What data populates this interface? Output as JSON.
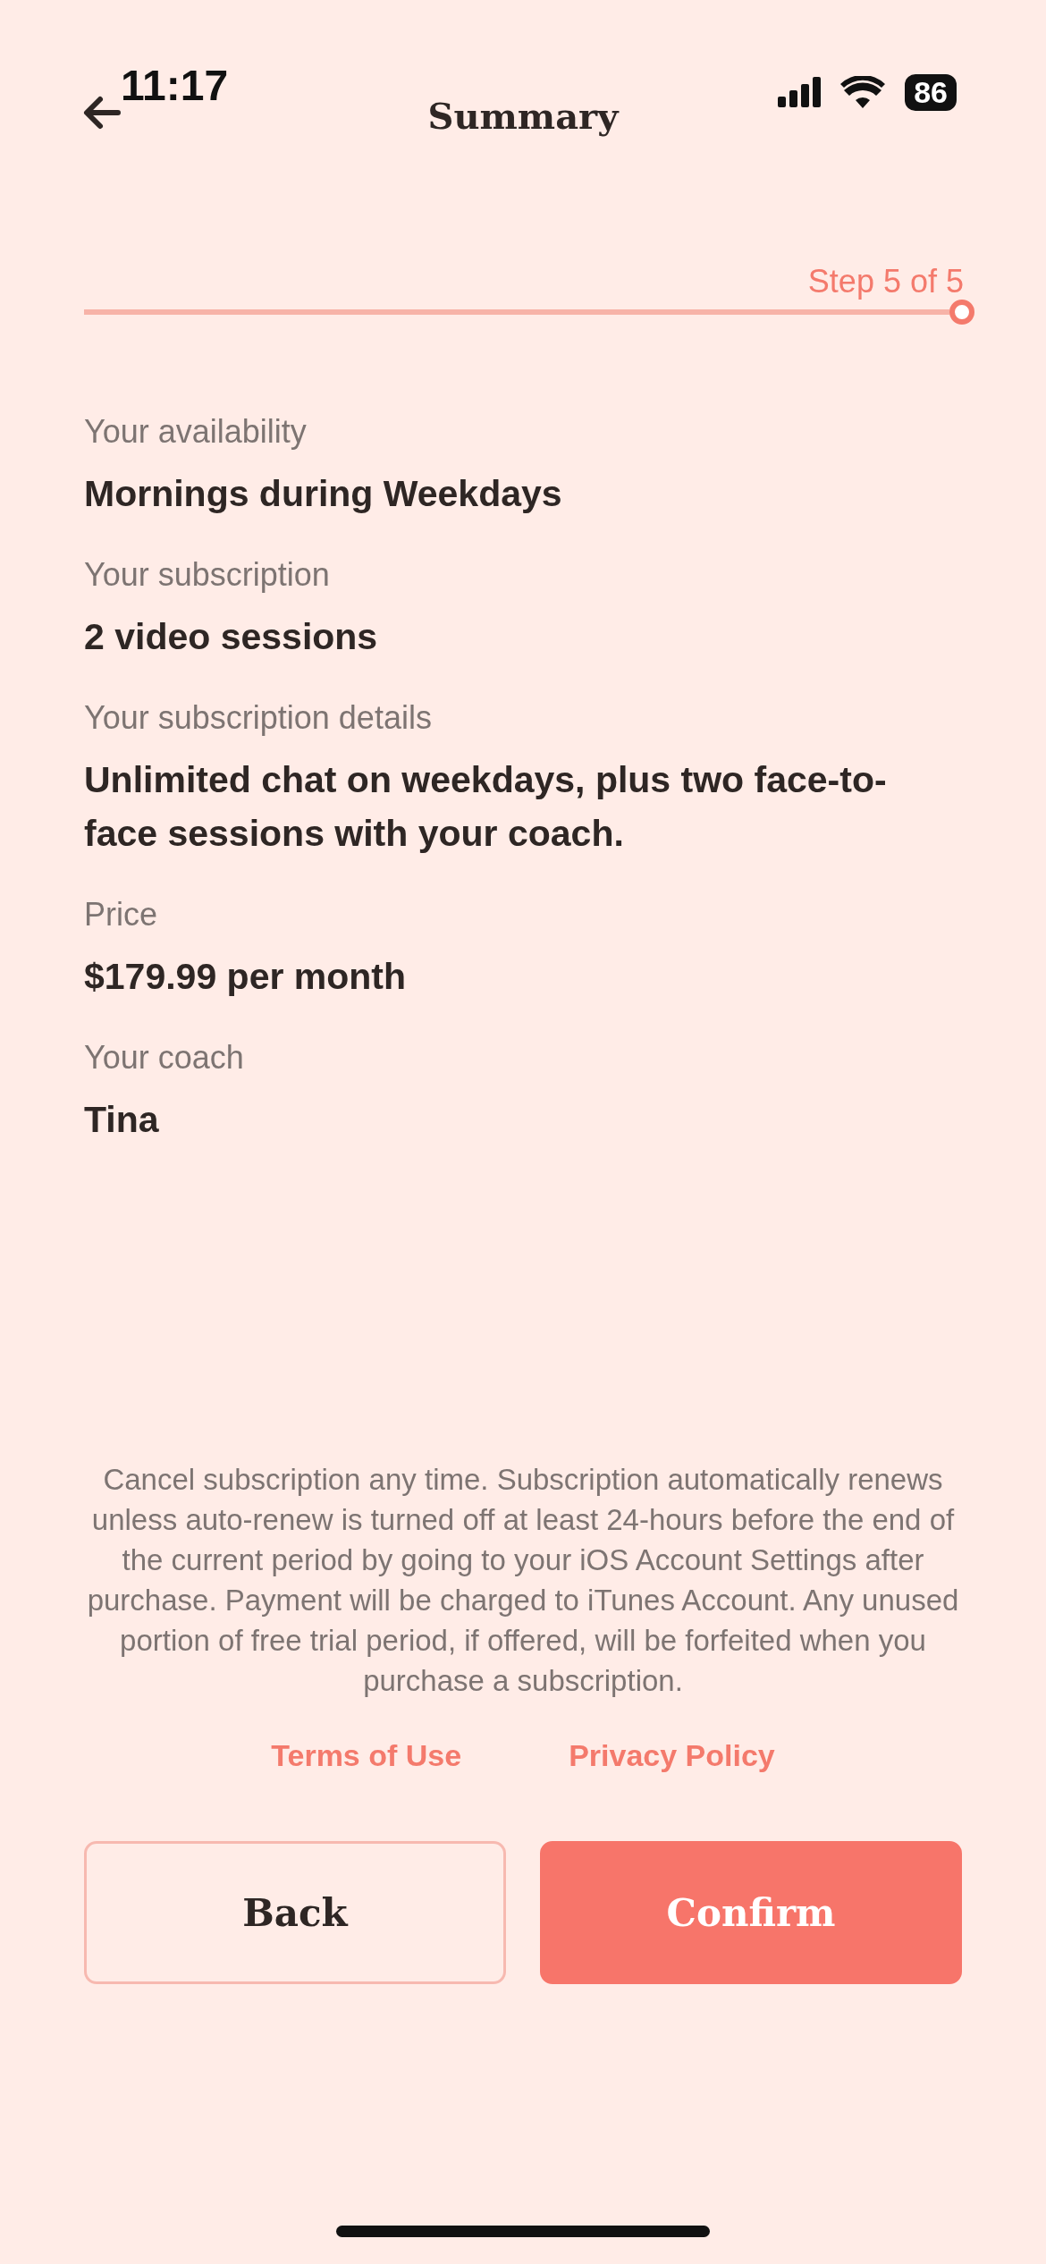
{
  "status_bar": {
    "time": "11:17",
    "battery": "86"
  },
  "header": {
    "title": "Summary"
  },
  "progress": {
    "label": "Step 5 of 5"
  },
  "fields": [
    {
      "label": "Your availability",
      "value": "Mornings during Weekdays"
    },
    {
      "label": "Your subscription",
      "value": "2 video sessions"
    },
    {
      "label": "Your subscription details",
      "value": "Unlimited chat on weekdays, plus two face-to-face sessions with your coach."
    },
    {
      "label": "Price",
      "value": "$179.99 per month"
    },
    {
      "label": "Your coach",
      "value": "Tina"
    }
  ],
  "disclaimer": "Cancel subscription any time. Subscription automatically renews unless auto-renew is turned off at least 24-hours before the end of the current period by going to your iOS Account Settings after purchase. Payment will be charged to iTunes Account. Any unused portion of free trial period, if offered, will be forfeited when you purchase a subscription.",
  "links": [
    "Terms of Use",
    "Privacy Policy"
  ],
  "buttons": [
    {
      "label": "Back",
      "kind": "secondary"
    },
    {
      "label": "Confirm",
      "kind": "primary"
    }
  ]
}
